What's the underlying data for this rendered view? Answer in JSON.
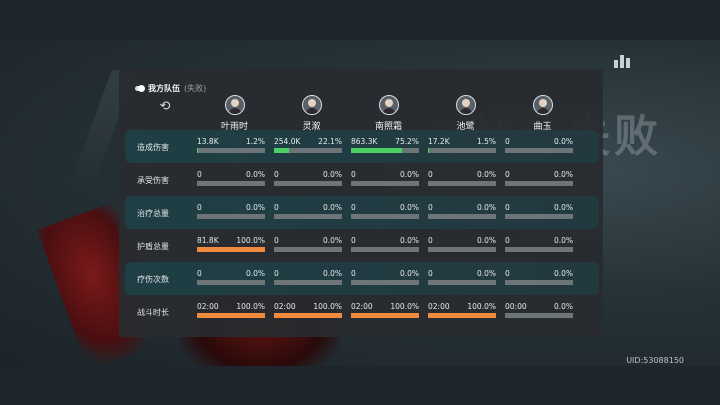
{
  "header": {
    "team_title": "我方队伍",
    "team_status": "(失败)"
  },
  "background": {
    "watermark": "战斗失败"
  },
  "uid": "UID:53088150",
  "characters": [
    {
      "name": "叶雨时"
    },
    {
      "name": "灵溆"
    },
    {
      "name": "南照霜"
    },
    {
      "name": "池鹭"
    },
    {
      "name": "曲玉"
    }
  ],
  "colors": {
    "damage_fill": "#4ccf63",
    "orange_fill": "#f08a3c",
    "bar_track": "#6e7579"
  },
  "rows": [
    {
      "label": "造成伤害",
      "fill": "damage",
      "cells": [
        {
          "value": "13.8K",
          "percent": "1.2%",
          "ratio": 0.012
        },
        {
          "value": "254.0K",
          "percent": "22.1%",
          "ratio": 0.221
        },
        {
          "value": "863.3K",
          "percent": "75.2%",
          "ratio": 0.752
        },
        {
          "value": "17.2K",
          "percent": "1.5%",
          "ratio": 0.015
        },
        {
          "value": "0",
          "percent": "0.0%",
          "ratio": 0
        }
      ]
    },
    {
      "label": "承受伤害",
      "fill": "orange",
      "cells": [
        {
          "value": "0",
          "percent": "0.0%",
          "ratio": 0
        },
        {
          "value": "0",
          "percent": "0.0%",
          "ratio": 0
        },
        {
          "value": "0",
          "percent": "0.0%",
          "ratio": 0
        },
        {
          "value": "0",
          "percent": "0.0%",
          "ratio": 0
        },
        {
          "value": "0",
          "percent": "0.0%",
          "ratio": 0
        }
      ]
    },
    {
      "label": "治疗总量",
      "fill": "orange",
      "cells": [
        {
          "value": "0",
          "percent": "0.0%",
          "ratio": 0
        },
        {
          "value": "0",
          "percent": "0.0%",
          "ratio": 0
        },
        {
          "value": "0",
          "percent": "0.0%",
          "ratio": 0
        },
        {
          "value": "0",
          "percent": "0.0%",
          "ratio": 0
        },
        {
          "value": "0",
          "percent": "0.0%",
          "ratio": 0
        }
      ]
    },
    {
      "label": "护盾总量",
      "fill": "orange",
      "cells": [
        {
          "value": "81.8K",
          "percent": "100.0%",
          "ratio": 1.0
        },
        {
          "value": "0",
          "percent": "0.0%",
          "ratio": 0
        },
        {
          "value": "0",
          "percent": "0.0%",
          "ratio": 0
        },
        {
          "value": "0",
          "percent": "0.0%",
          "ratio": 0
        },
        {
          "value": "0",
          "percent": "0.0%",
          "ratio": 0
        }
      ]
    },
    {
      "label": "疗伤次数",
      "fill": "orange",
      "cells": [
        {
          "value": "0",
          "percent": "0.0%",
          "ratio": 0
        },
        {
          "value": "0",
          "percent": "0.0%",
          "ratio": 0
        },
        {
          "value": "0",
          "percent": "0.0%",
          "ratio": 0
        },
        {
          "value": "0",
          "percent": "0.0%",
          "ratio": 0
        },
        {
          "value": "0",
          "percent": "0.0%",
          "ratio": 0
        }
      ]
    },
    {
      "label": "战斗时长",
      "fill": "orange",
      "cells": [
        {
          "value": "02:00",
          "percent": "100.0%",
          "ratio": 1.0
        },
        {
          "value": "02:00",
          "percent": "100.0%",
          "ratio": 1.0
        },
        {
          "value": "02:00",
          "percent": "100.0%",
          "ratio": 1.0
        },
        {
          "value": "02:00",
          "percent": "100.0%",
          "ratio": 1.0
        },
        {
          "value": "00:00",
          "percent": "0.0%",
          "ratio": 0
        }
      ]
    }
  ]
}
